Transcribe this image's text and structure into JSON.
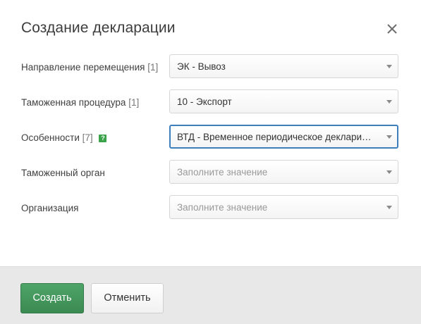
{
  "dialog": {
    "title": "Создание декларации"
  },
  "fields": [
    {
      "label": "Направление перемещения",
      "count": "[1]",
      "value": "ЭК - Вывоз",
      "placeholder": ""
    },
    {
      "label": "Таможенная процедура",
      "count": "[1]",
      "value": "10 - Экспорт",
      "placeholder": ""
    },
    {
      "label": "Особенности",
      "count": "[7]",
      "value": "ВТД - Временное периодическое декларирование",
      "placeholder": ""
    },
    {
      "label": "Таможенный орган",
      "count": "",
      "value": "",
      "placeholder": "Заполните значение"
    },
    {
      "label": "Организация",
      "count": "",
      "value": "",
      "placeholder": "Заполните значение"
    }
  ],
  "help_icon": {
    "glyph": "?",
    "color": "#3aa34a"
  },
  "buttons": {
    "create": "Создать",
    "cancel": "Отменить"
  },
  "colors": {
    "primary": "#3b8a52",
    "focus_border": "#3d7fbd",
    "footer_bg": "#e8e8e8"
  }
}
